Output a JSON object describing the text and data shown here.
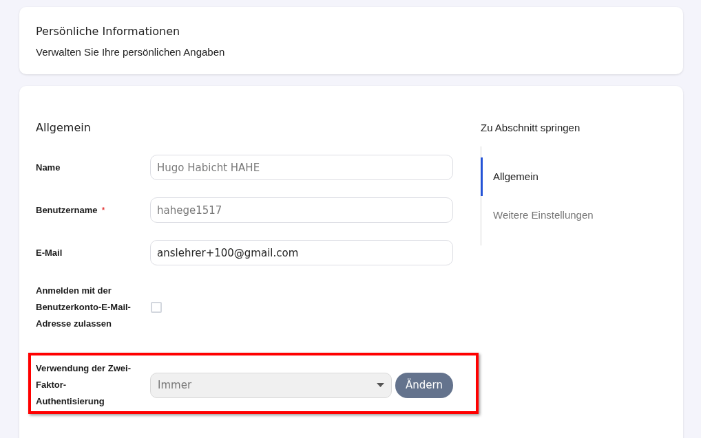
{
  "header": {
    "title": "Persönliche Informationen",
    "subtitle": "Verwalten Sie Ihre persönlichen Angaben"
  },
  "section": {
    "title": "Allgemein",
    "fields": [
      {
        "kind": "text",
        "label": "Name",
        "value": "Hugo Habicht HAHE",
        "disabled": true
      },
      {
        "kind": "text",
        "label": "Benutzername",
        "required_mark": "*",
        "value": "hahege1517",
        "disabled": true
      },
      {
        "kind": "text",
        "label": "E-Mail",
        "value": "anslehrer+100@gmail.com",
        "disabled": false
      },
      {
        "kind": "checkbox",
        "label": "Anmelden mit der Benutzerkonto-E-Mail-Adresse zulassen",
        "checked": false
      },
      {
        "kind": "select",
        "label": "Verwendung der Zwei-Faktor-Authentisierung",
        "value": "Immer",
        "disabled": true,
        "button": "Ändern",
        "highlighted": true
      }
    ]
  },
  "jump_nav": {
    "title": "Zu Abschnitt springen",
    "items": [
      {
        "label": "Allgemein",
        "selected": true
      },
      {
        "label": "Weitere Einstellungen",
        "selected": false
      }
    ]
  }
}
